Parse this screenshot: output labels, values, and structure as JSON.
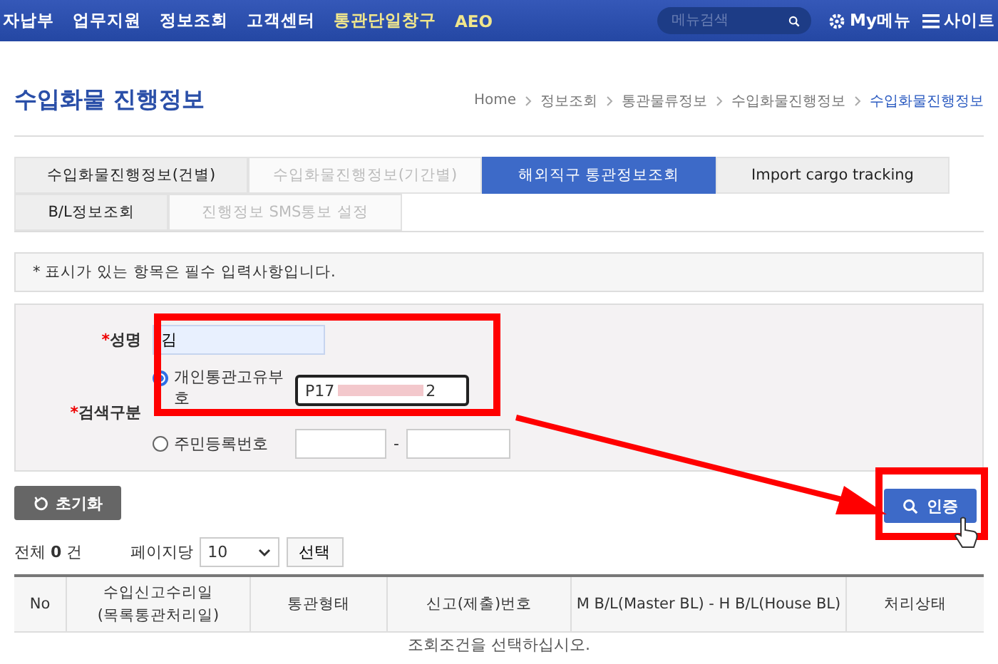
{
  "nav": {
    "items": [
      {
        "label": "자납부",
        "highlighted": false
      },
      {
        "label": "업무지원",
        "highlighted": false
      },
      {
        "label": "정보조회",
        "highlighted": false
      },
      {
        "label": "고객센터",
        "highlighted": false
      },
      {
        "label": "통관단일창구",
        "highlighted": true
      },
      {
        "label": "AEO",
        "highlighted": true
      }
    ],
    "search": {
      "placeholder": "메뉴검색"
    },
    "my_menu": "My메뉴",
    "sitemap": "사이트"
  },
  "page_title": "수입화물 진행정보",
  "breadcrumb": [
    {
      "label": "Home",
      "current": false
    },
    {
      "label": "정보조회",
      "current": false
    },
    {
      "label": "통관물류정보",
      "current": false
    },
    {
      "label": "수입화물진행정보",
      "current": false
    },
    {
      "label": "수입화물진행정보",
      "current": true
    }
  ],
  "tab_rows": [
    {
      "tabs": [
        {
          "label": "수입화물진행정보(건별)",
          "selected": false,
          "dimmed": false
        },
        {
          "label": "수입화물진행정보(기간별)",
          "selected": false,
          "dimmed": true
        },
        {
          "label": "해외직구 통관정보조회",
          "selected": true,
          "dimmed": false
        },
        {
          "label": "Import cargo tracking",
          "selected": false,
          "dimmed": false
        }
      ]
    },
    {
      "tabs": [
        {
          "label": "B/L정보조회",
          "selected": false,
          "dimmed": false
        },
        {
          "label": "진행정보 SMS통보 설정",
          "selected": false,
          "dimmed": true
        }
      ]
    }
  ],
  "notice": "* 표시가 있는 항목은 필수 입력사항입니다.",
  "form": {
    "name": {
      "required_mark": "*",
      "label": "성명",
      "value": "김"
    },
    "search_type": {
      "required_mark": "*",
      "label": "검색구분",
      "options": [
        {
          "kind": "single",
          "label": "개인통관고유부호",
          "selected": true,
          "value_start": "P17",
          "value_end": "2"
        },
        {
          "kind": "split",
          "label": "주민등록번호",
          "selected": false,
          "separator": "-"
        }
      ]
    }
  },
  "reset_button": "초기화",
  "search_button": "인증",
  "list": {
    "total_label": "전체",
    "total": "0",
    "unit": "건",
    "per_page_label": "페이지당",
    "per_page": "10",
    "select_button": "선택"
  },
  "table": {
    "columns": [
      {
        "lines": [
          "No"
        ]
      },
      {
        "lines": [
          "수입신고수리일",
          "(목록통관처리일)"
        ]
      },
      {
        "lines": [
          "통관형태"
        ]
      },
      {
        "lines": [
          "신고(제출)번호"
        ]
      },
      {
        "lines": [
          "M B/L(Master BL) - H B/L(House BL)"
        ]
      },
      {
        "lines": [
          "처리상태"
        ]
      }
    ],
    "empty_message": "조회조건을 선택하십시오."
  }
}
